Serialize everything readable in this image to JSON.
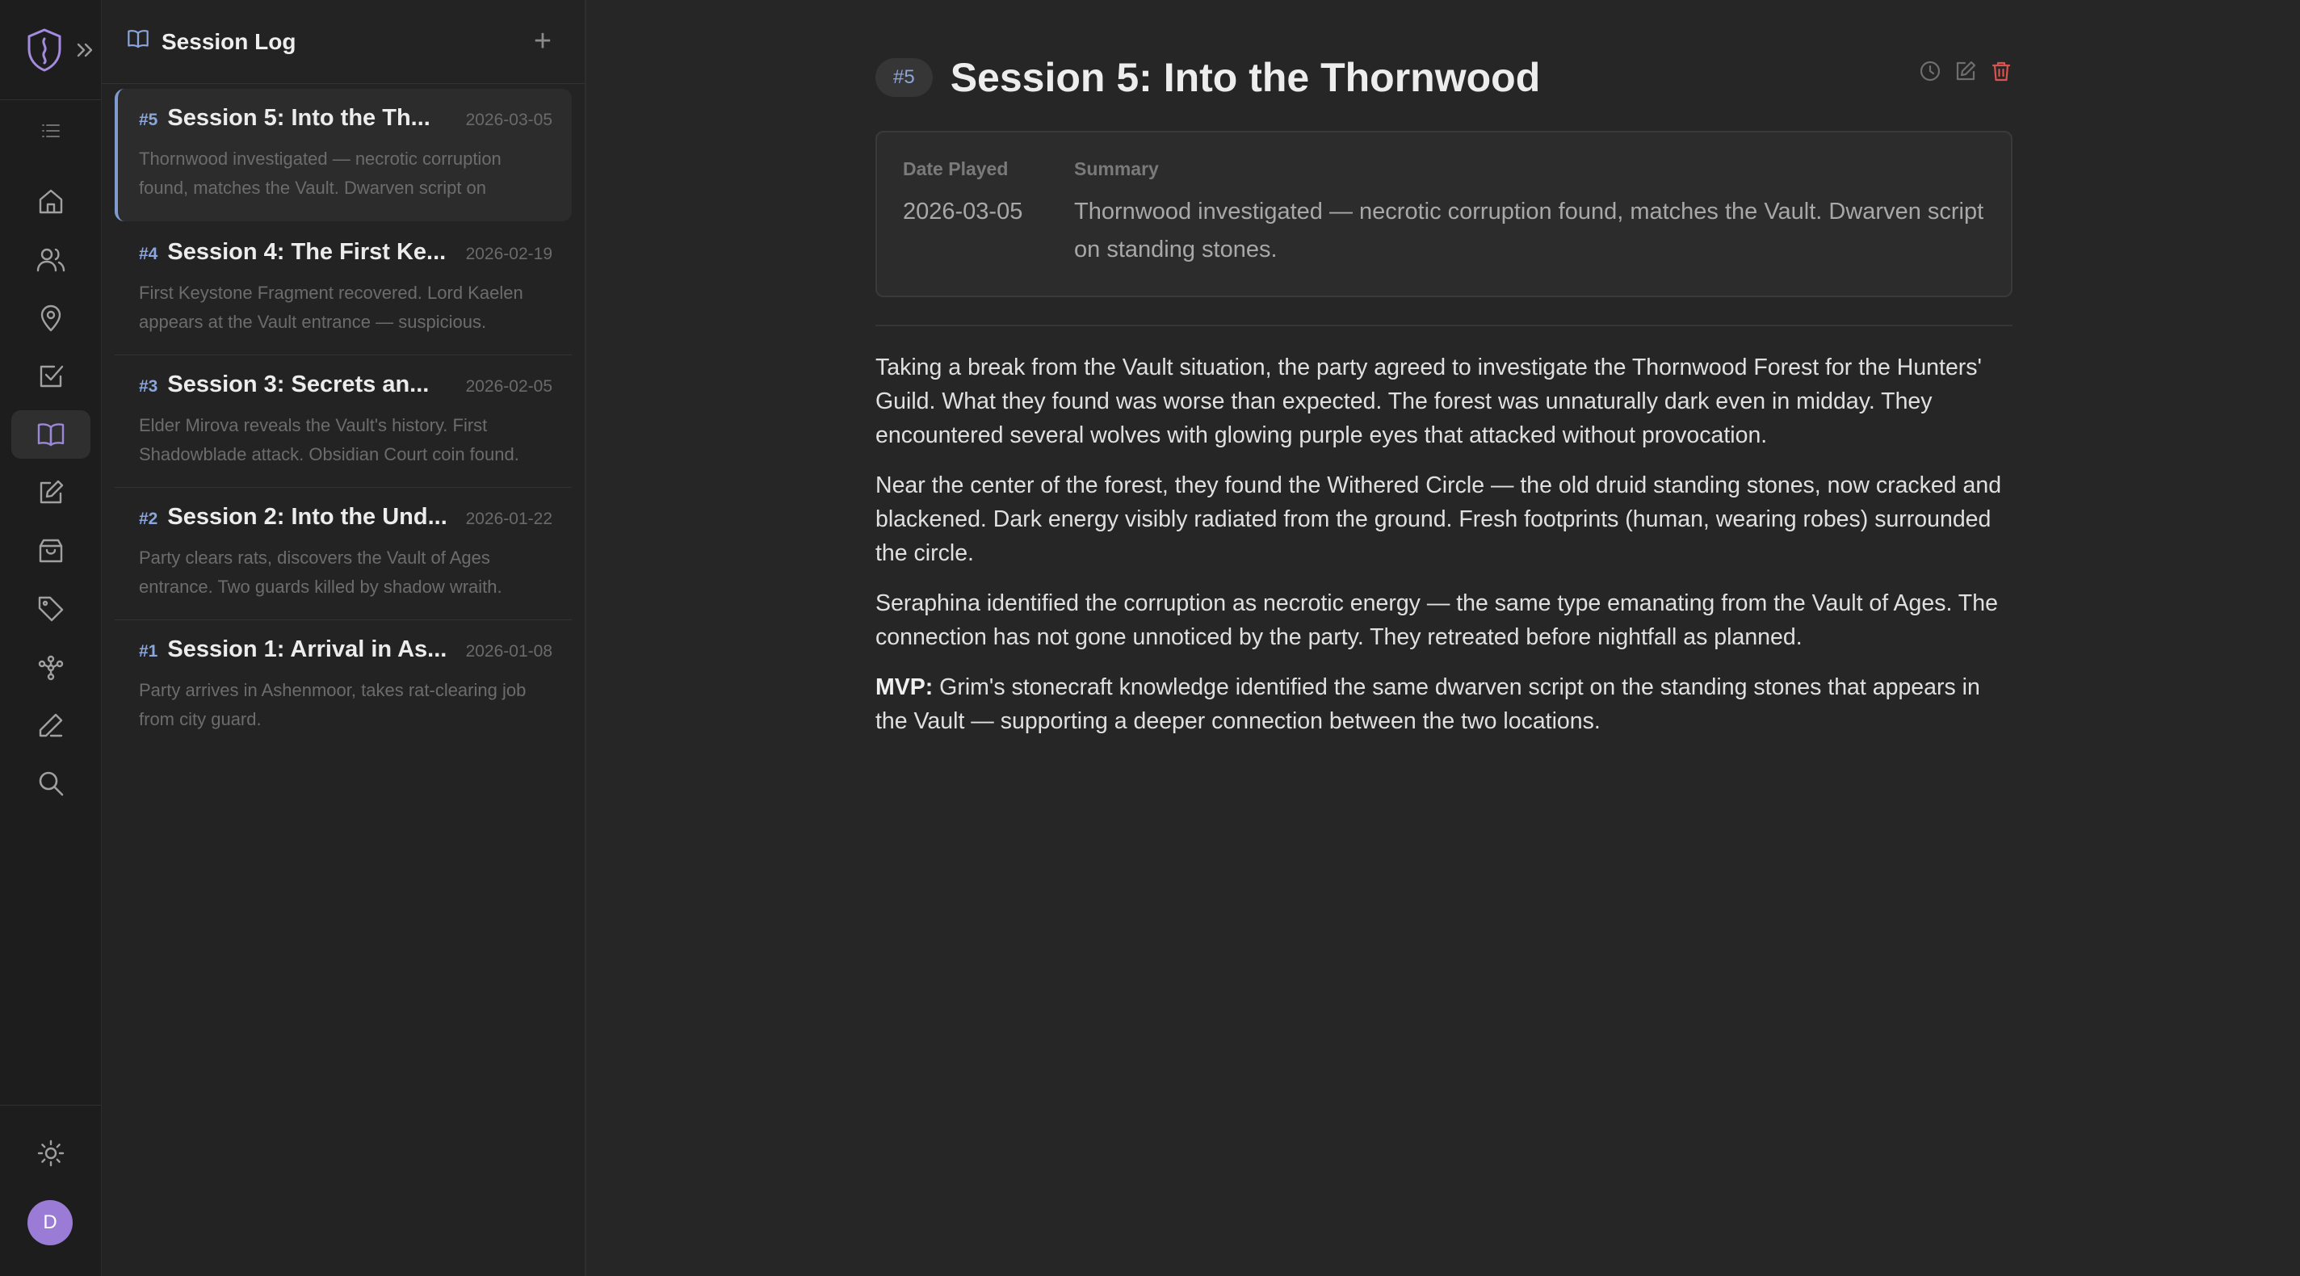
{
  "panel": {
    "title": "Session Log",
    "add_label": "+"
  },
  "sessions": [
    {
      "num": "#5",
      "title": "Session 5: Into the Th...",
      "date": "2026-03-05",
      "desc": "Thornwood investigated — necrotic corruption found, matches the Vault. Dwarven script on"
    },
    {
      "num": "#4",
      "title": "Session 4: The First Ke...",
      "date": "2026-02-19",
      "desc": "First Keystone Fragment recovered. Lord Kaelen appears at the Vault entrance — suspicious."
    },
    {
      "num": "#3",
      "title": "Session 3: Secrets an...",
      "date": "2026-02-05",
      "desc": "Elder Mirova reveals the Vault's history. First Shadowblade attack. Obsidian Court coin found."
    },
    {
      "num": "#2",
      "title": "Session 2: Into the Und...",
      "date": "2026-01-22",
      "desc": "Party clears rats, discovers the Vault of Ages entrance. Two guards killed by shadow wraith."
    },
    {
      "num": "#1",
      "title": "Session 1: Arrival in As...",
      "date": "2026-01-08",
      "desc": "Party arrives in Ashenmoor, takes rat-clearing job from city guard."
    }
  ],
  "detail": {
    "num": "#5",
    "title": "Session 5: Into the Thornwood",
    "date_label": "Date Played",
    "date_value": "2026-03-05",
    "summary_label": "Summary",
    "summary_value": "Thornwood investigated — necrotic corruption found, matches the Vault. Dwarven script on standing stones.",
    "paragraphs": [
      "Taking a break from the Vault situation, the party agreed to investigate the Thornwood Forest for the Hunters' Guild. What they found was worse than expected. The forest was unnaturally dark even in midday. They encountered several wolves with glowing purple eyes that attacked without provocation.",
      "Near the center of the forest, they found the Withered Circle — the old druid standing stones, now cracked and blackened. Dark energy visibly radiated from the ground. Fresh footprints (human, wearing robes) surrounded the circle.",
      "Seraphina identified the corruption as necrotic energy — the same type emanating from the Vault of Ages. The connection has not gone unnoticed by the party. They retreated before nightfall as planned."
    ],
    "mvp_label": "MVP:",
    "mvp_text": " Grim's stonecraft knowledge identified the same dwarven script on the standing stones that appears in the Vault — supporting a deeper connection between the two locations."
  },
  "user": {
    "avatar_initial": "D"
  },
  "colors": {
    "accent": "#8aa6dc",
    "active_border": "#7f9cd2",
    "logo": "#a48be0",
    "avatar": "#9a7cd6",
    "delete": "#d9534f"
  },
  "icons": [
    "logo-icon",
    "expand-icon",
    "list-icon",
    "home-icon",
    "users-icon",
    "location-icon",
    "checklist-icon",
    "book-icon",
    "notes-icon",
    "inventory-icon",
    "tag-icon",
    "network-icon",
    "pen-icon",
    "search-icon",
    "sun-icon",
    "clock-icon",
    "edit-icon",
    "trash-icon",
    "plus-icon"
  ]
}
